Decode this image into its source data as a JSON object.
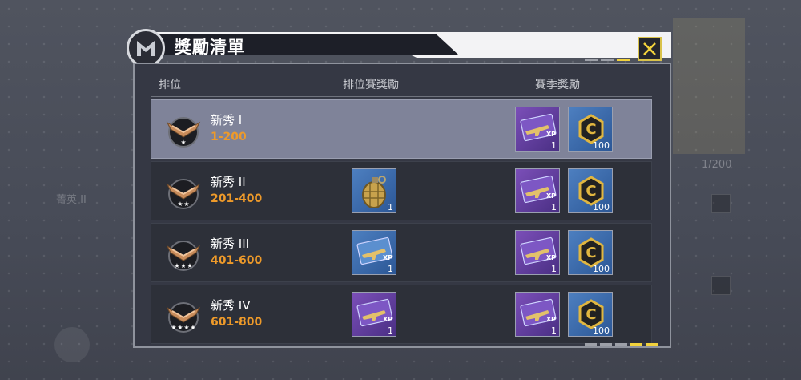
{
  "dialog": {
    "title": "獎勵清單"
  },
  "columns": {
    "rank": "排位",
    "ranked_reward": "排位賽獎勵",
    "season_reward": "賽季獎勵"
  },
  "rows": [
    {
      "name": "新秀 I",
      "range": "1-200",
      "selected": true,
      "ranked_reward": null,
      "season_rewards": [
        {
          "icon": "weapon-xp-card-icon",
          "qty": "1"
        },
        {
          "icon": "cp-coin-icon",
          "qty": "100"
        }
      ]
    },
    {
      "name": "新秀 II",
      "range": "201-400",
      "selected": false,
      "ranked_reward": {
        "icon": "gold-grenade-icon",
        "qty": "1"
      },
      "season_rewards": [
        {
          "icon": "weapon-xp-card-icon",
          "qty": "1"
        },
        {
          "icon": "cp-coin-icon",
          "qty": "100"
        }
      ]
    },
    {
      "name": "新秀 III",
      "range": "401-600",
      "selected": false,
      "ranked_reward": {
        "icon": "blue-weapon-xp-card-icon",
        "qty": "1"
      },
      "season_rewards": [
        {
          "icon": "weapon-xp-card-icon",
          "qty": "1"
        },
        {
          "icon": "cp-coin-icon",
          "qty": "100"
        }
      ]
    },
    {
      "name": "新秀 IV",
      "range": "601-800",
      "selected": false,
      "ranked_reward": {
        "icon": "weapon-xp-card-icon",
        "qty": "1"
      },
      "season_rewards": [
        {
          "icon": "weapon-xp-card-icon",
          "qty": "1"
        },
        {
          "icon": "cp-coin-icon",
          "qty": "100"
        }
      ]
    }
  ],
  "background": {
    "left_rank": "菁英 II",
    "right_progress": "1/200"
  },
  "colors": {
    "accent_yellow": "#f2d23c",
    "rank_range_orange": "#ee9a2a",
    "selected_row": "#7f8399"
  }
}
